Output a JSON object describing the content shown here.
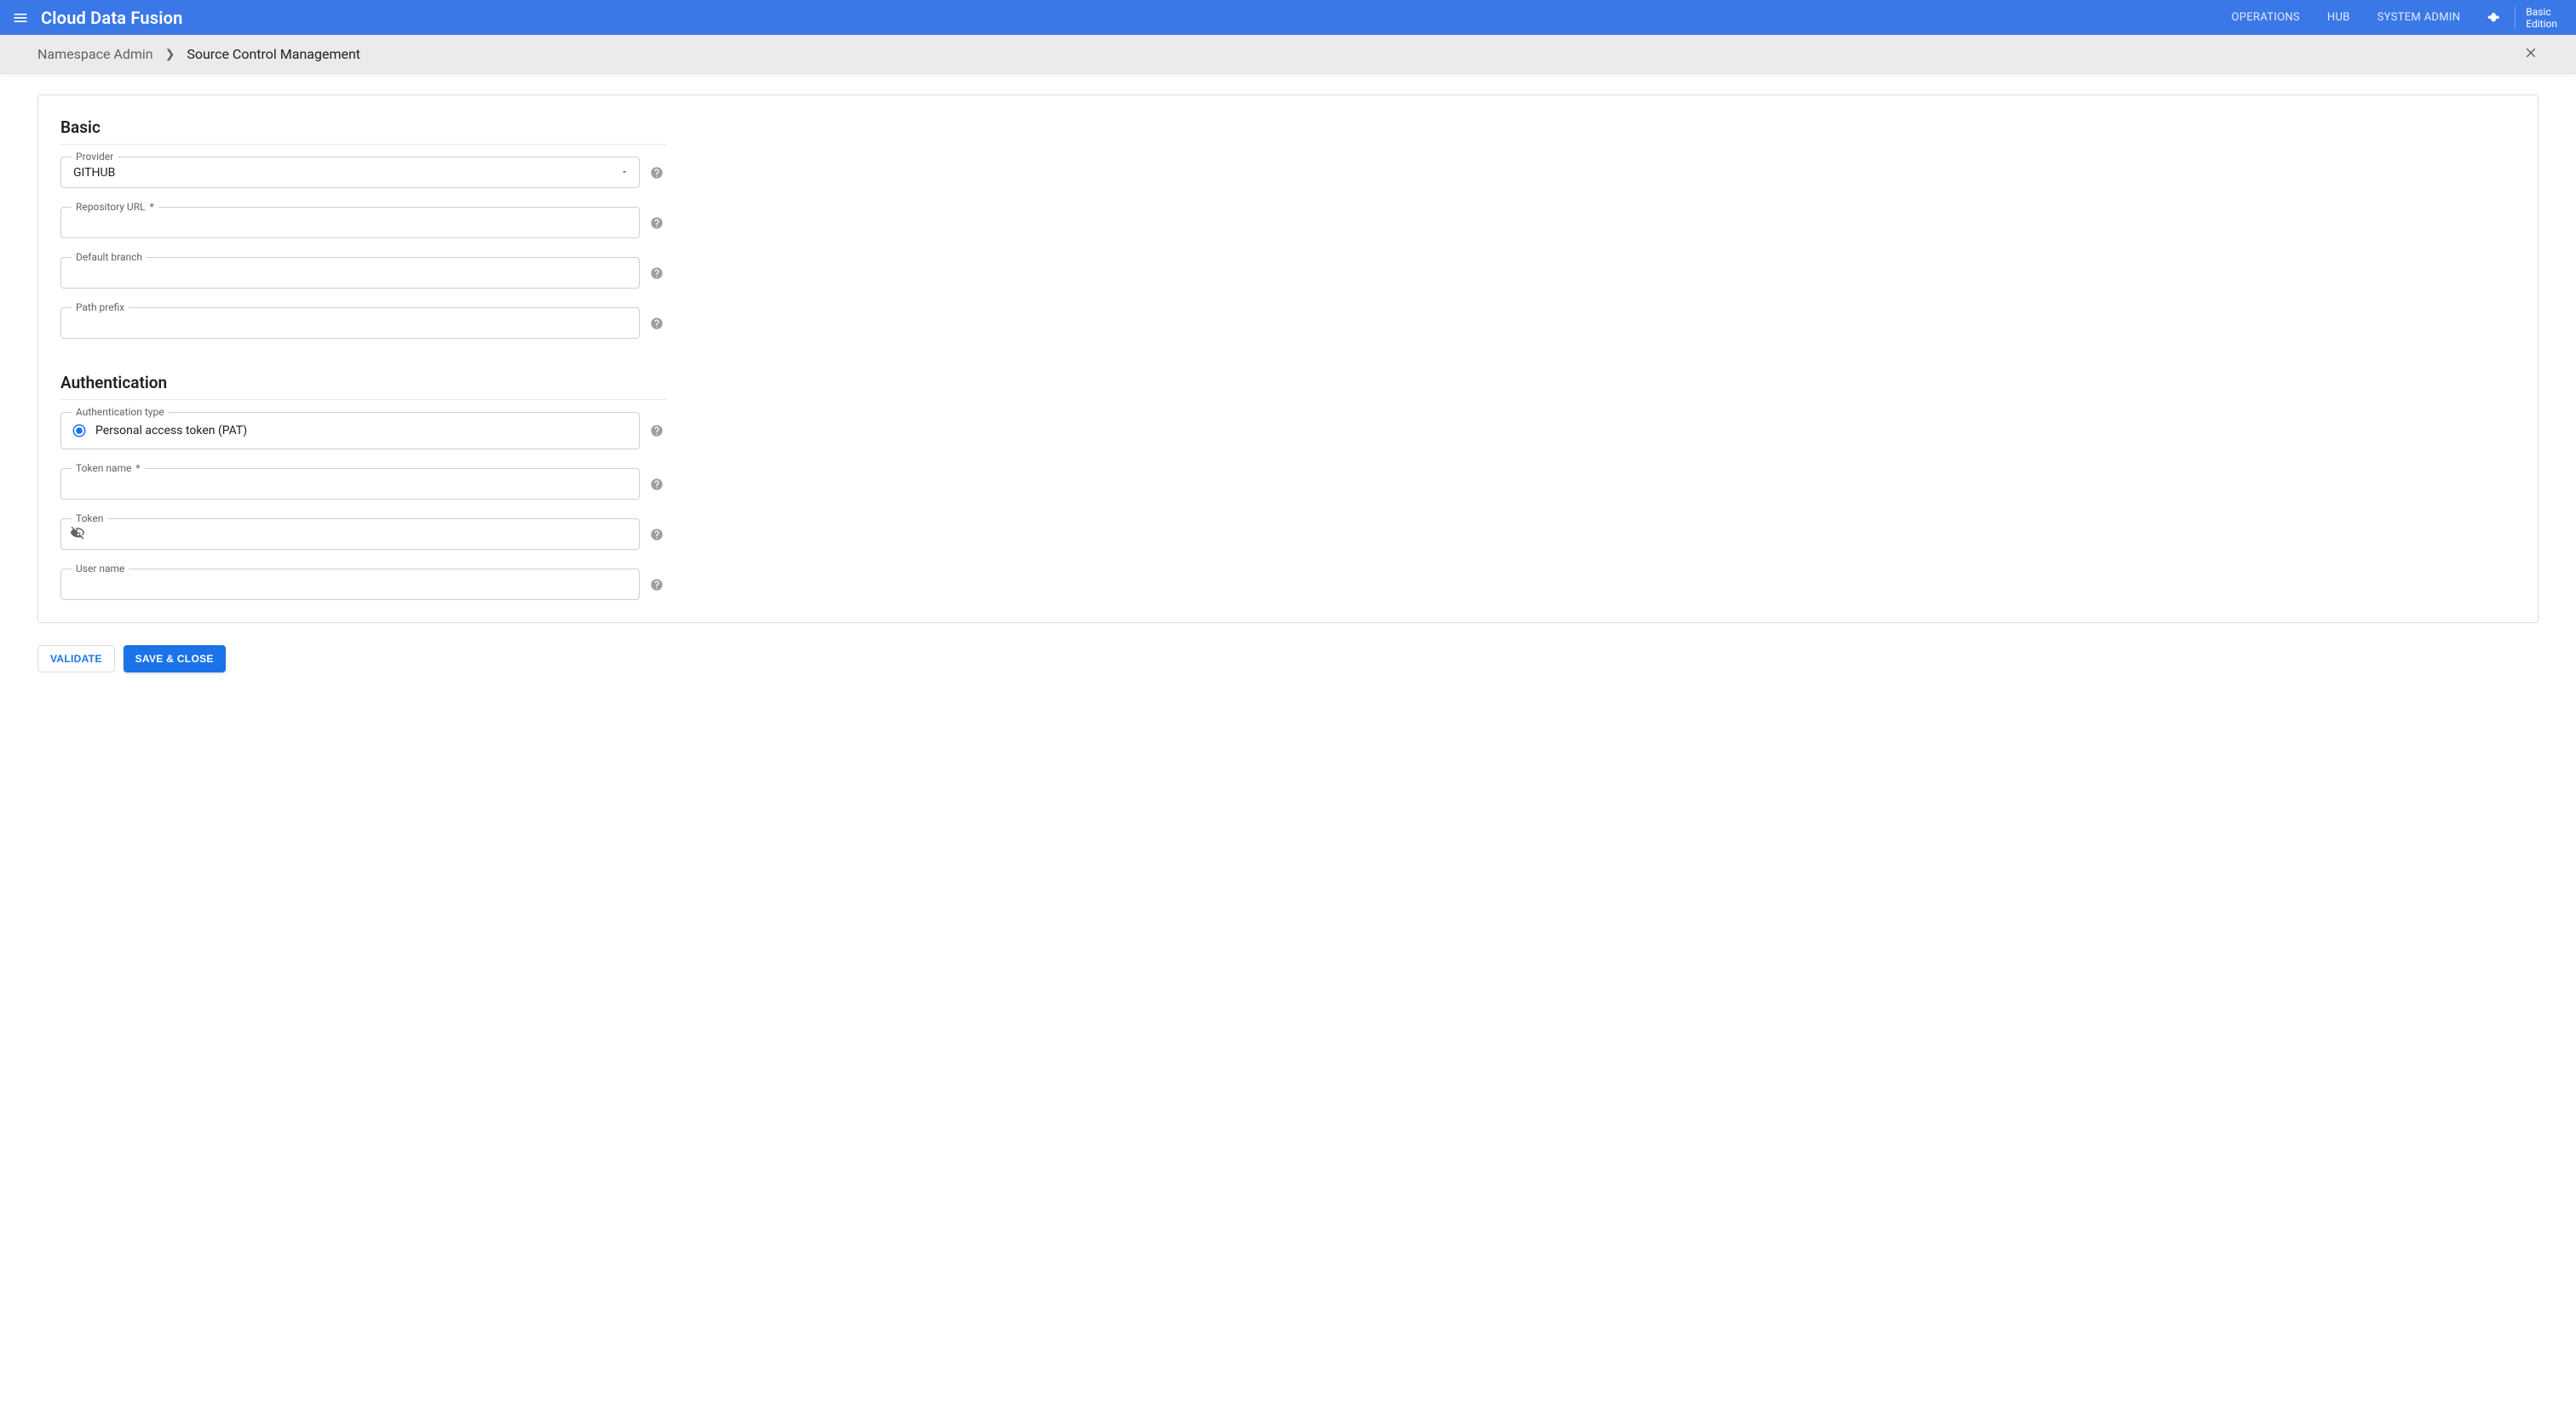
{
  "header": {
    "brand": "Cloud Data Fusion",
    "nav": {
      "operations": "OPERATIONS",
      "hub": "HUB",
      "system_admin": "SYSTEM ADMIN"
    },
    "edition_line1": "Basic",
    "edition_line2": "Edition"
  },
  "breadcrumb": {
    "parent": "Namespace Admin",
    "current": "Source Control Management"
  },
  "sections": {
    "basic": {
      "title": "Basic"
    },
    "auth": {
      "title": "Authentication"
    }
  },
  "fields": {
    "provider": {
      "label": "Provider",
      "value": "GITHUB"
    },
    "repo_url": {
      "label": "Repository URL",
      "required": "*",
      "value": ""
    },
    "default_branch": {
      "label": "Default branch",
      "value": ""
    },
    "path_prefix": {
      "label": "Path prefix",
      "value": ""
    },
    "auth_type": {
      "label": "Authentication type",
      "option": "Personal access token (PAT)"
    },
    "token_name": {
      "label": "Token name",
      "required": "*",
      "value": ""
    },
    "token": {
      "label": "Token",
      "value": ""
    },
    "user_name": {
      "label": "User name",
      "value": ""
    }
  },
  "buttons": {
    "validate": "VALIDATE",
    "save_close": "SAVE & CLOSE"
  }
}
